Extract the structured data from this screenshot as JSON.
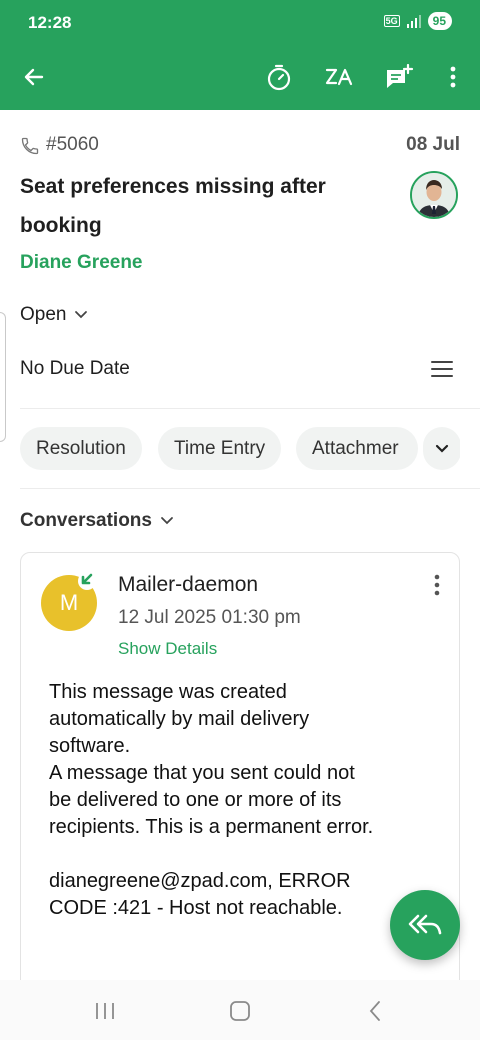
{
  "status_bar": {
    "time": "12:28",
    "network": "5G",
    "battery": "95"
  },
  "app_bar": {
    "icons": [
      "back-arrow-icon",
      "timer-icon",
      "translate-icon",
      "add-comment-icon",
      "more-vertical-icon"
    ]
  },
  "ticket": {
    "id": "#5060",
    "date": "08 Jul",
    "subject": "Seat preferences missing after booking",
    "requester": "Diane Greene",
    "status": "Open",
    "due_date": "No Due Date"
  },
  "tabs": [
    "Resolution",
    "Time Entry",
    "Attachmer"
  ],
  "conversations": {
    "header": "Conversations",
    "items": [
      {
        "avatar_letter": "M",
        "sender": "Mailer-daemon",
        "time": "12 Jul 2025 01:30 pm",
        "show_details": "Show Details",
        "body_lines": [
          "This message was created",
          "automatically by mail delivery",
          "software.",
          "A message that you sent could not",
          "be delivered to one or more of its",
          "recipients. This is a permanent error.",
          "",
          "dianegreene@zpad.com, ERROR",
          "CODE :421 - Host not reachable."
        ]
      }
    ]
  },
  "colors": {
    "brand": "#27a25d",
    "avatar_m": "#e8c12b"
  }
}
